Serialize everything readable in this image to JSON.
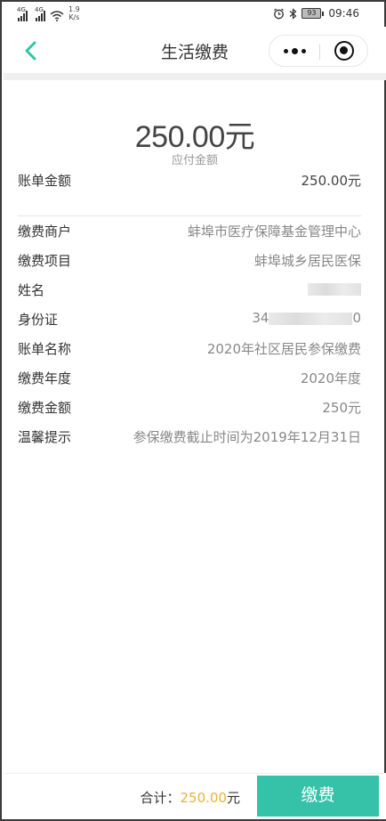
{
  "status_bar": {
    "network_1": "4G",
    "network_2": "4G",
    "speed": "1.9",
    "speed_unit": "K/s",
    "battery": "93",
    "time": "09:46"
  },
  "header": {
    "title": "生活缴费"
  },
  "amount": {
    "value": "250.00元",
    "label": "应付金额"
  },
  "bill_amount": {
    "label": "账单金额",
    "value": "250.00元"
  },
  "details": [
    {
      "label": "缴费商户",
      "value": "蚌埠市医疗保障基金管理中心"
    },
    {
      "label": "缴费项目",
      "value": "蚌埠城乡居民医保"
    },
    {
      "label": "姓名",
      "value": ""
    },
    {
      "label": "身份证",
      "value_prefix": "34",
      "value_suffix": "0"
    },
    {
      "label": "账单名称",
      "value": "2020年社区居民参保缴费"
    },
    {
      "label": "缴费年度",
      "value": "2020年度"
    },
    {
      "label": "缴费金额",
      "value": "250元"
    },
    {
      "label": "温馨提示",
      "value": "参保缴费截止时间为2019年12月31日"
    }
  ],
  "footer": {
    "total_label": "合计：",
    "total_value": "250.00",
    "total_unit": "元",
    "pay_button": "缴费"
  },
  "colors": {
    "accent": "#35c2a8",
    "total_amount": "#e8b434"
  }
}
